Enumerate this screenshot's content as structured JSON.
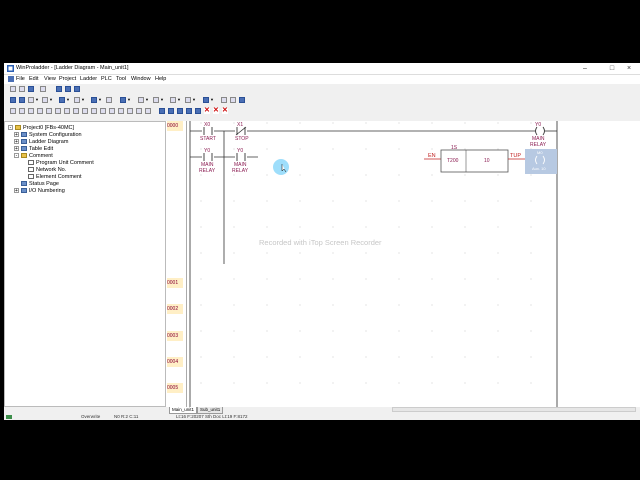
{
  "window": {
    "title": "WinProladder - [Ladder Diagram - Main_unit1]"
  },
  "window_buttons": {
    "minimize": "–",
    "maximize": "□",
    "close": "×"
  },
  "menu": [
    "File",
    "Edit",
    "View",
    "Project",
    "Ladder",
    "PLC",
    "Tool",
    "Window",
    "Help"
  ],
  "toolbar_icons": [
    "new-icon",
    "open-icon",
    "save-icon",
    "print-icon",
    "cut-icon",
    "copy-icon",
    "paste-icon",
    "undo-icon",
    "redo-icon",
    "find-icon",
    "zoom-icon",
    "compile-icon",
    "run-icon",
    "stop-icon",
    "monitor-icon",
    "online-icon",
    "delete-icon",
    "close-icon"
  ],
  "tree": {
    "root": "Project0 [FBs-40MC]",
    "items": [
      {
        "label": "System Configuration",
        "level": 1,
        "expander": "+"
      },
      {
        "label": "Ladder Diagram",
        "level": 1,
        "expander": "+"
      },
      {
        "label": "Table Edit",
        "level": 1,
        "expander": "+"
      },
      {
        "label": "Comment",
        "level": 1,
        "expander": "-"
      },
      {
        "label": "Program Unit Comment",
        "level": 2,
        "expander": ""
      },
      {
        "label": "Network No.",
        "level": 2,
        "expander": ""
      },
      {
        "label": "Element Comment",
        "level": 2,
        "expander": ""
      },
      {
        "label": "Status Page",
        "level": 1,
        "expander": ""
      },
      {
        "label": "I/O Numbering",
        "level": 1,
        "expander": "+"
      }
    ]
  },
  "ladder": {
    "networks": [
      "0000",
      "0001",
      "0002",
      "0003",
      "0004",
      "0005"
    ],
    "network0": {
      "contact_x0": {
        "address": "X0",
        "label": "START"
      },
      "contact_x1": {
        "address": "X1",
        "label": "STOP"
      },
      "coil_y0": {
        "address": "Y0",
        "label1": "MAIN",
        "label2": "RELAY"
      },
      "branch_contact_y0": {
        "address": "Y0",
        "label1": "MAIN",
        "label2": "RELAY"
      },
      "contact_y0_2": {
        "address": "Y0",
        "label1": "MAIN",
        "label2": "RELAY"
      },
      "timer": {
        "en": "EN",
        "tup": "TUP",
        "base": "1S",
        "number": "T200",
        "preset": "10"
      },
      "selected_coil": {
        "address": "M0",
        "label": "Aux. 10"
      }
    },
    "watermark": "Recorded with iTop Screen Recorder"
  },
  "tabs": [
    "Main_unit1",
    "Sub_unit1"
  ],
  "status": {
    "mode": "Overwrite",
    "position": "N0 R:2 C:11",
    "memory": "Lt:16 F:20207 Sth Doc Lt:19 F:8172"
  }
}
